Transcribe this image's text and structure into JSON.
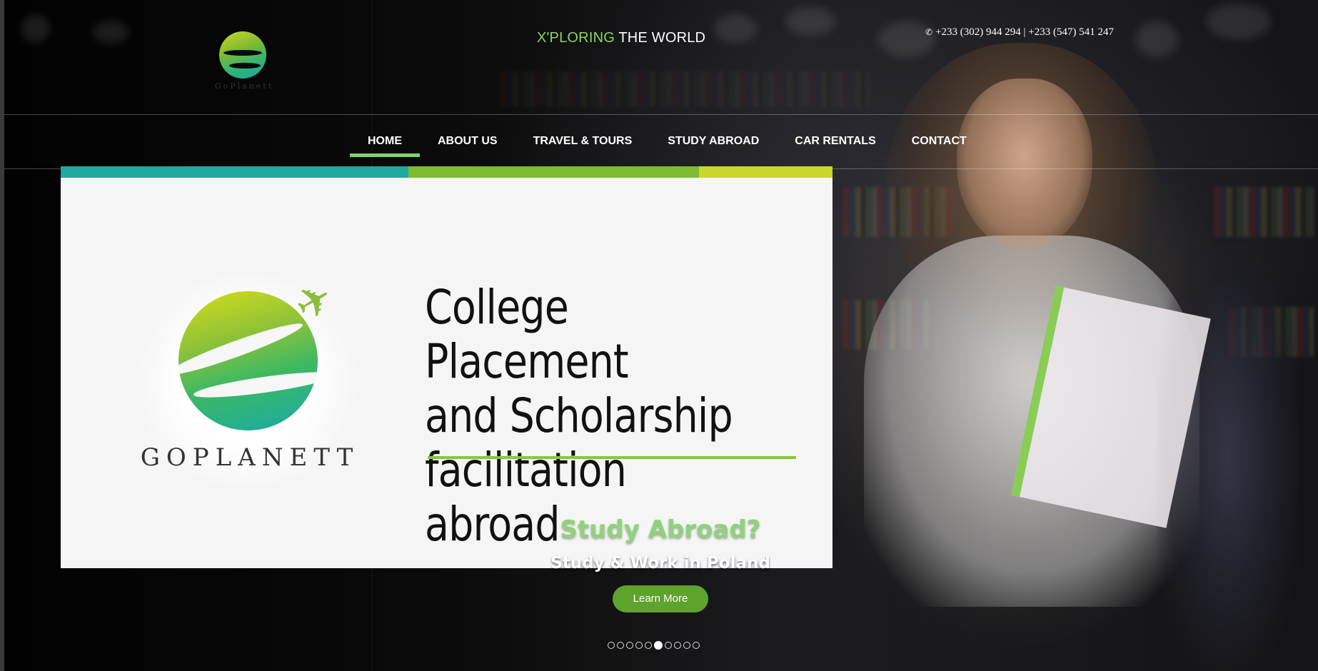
{
  "header": {
    "logo_text": "GoPlanett",
    "tagline_accent": "X'PLORING",
    "tagline_rest": " THE WORLD",
    "phone_icon": "phone-icon",
    "phones": "+233 (302) 944 294 | +233 (547) 541 247"
  },
  "nav": {
    "items": [
      {
        "label": "HOME",
        "active": true
      },
      {
        "label": "ABOUT US",
        "active": false
      },
      {
        "label": "TRAVEL & TOURS",
        "active": false
      },
      {
        "label": "STUDY ABROAD",
        "active": false
      },
      {
        "label": "CAR RENTALS",
        "active": false
      },
      {
        "label": "CONTACT",
        "active": false
      }
    ],
    "active_underline_color": "#7fd36a"
  },
  "banner": {
    "brand": "GOPLANETT",
    "headline_line1": "College Placement",
    "headline_line2": "and Scholarship",
    "headline_line3": "facilitation abroad",
    "colors": {
      "teal": "#1ea8a0",
      "green": "#7dbb31",
      "lime": "#c9d62a"
    }
  },
  "slide": {
    "title": "Study Abroad?",
    "subtitle": "Study & Work in Poland",
    "button_label": "Learn More",
    "total_slides": 10,
    "active_slide": 6
  }
}
